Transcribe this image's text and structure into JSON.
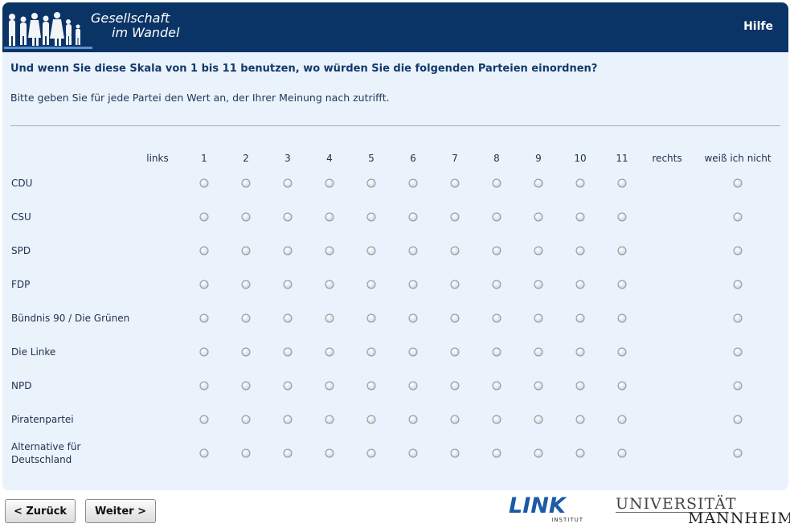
{
  "header": {
    "logo_line1": "Gesellschaft",
    "logo_line2": "im Wandel",
    "help_label": "Hilfe"
  },
  "question": "Und wenn Sie diese Skala von 1 bis 11 benutzen, wo würden Sie die folgenden Parteien einordnen?",
  "instruction": "Bitte geben Sie für jede Partei den Wert an, der Ihrer Meinung nach zutrifft.",
  "scale": {
    "left_label": "links",
    "values": [
      "1",
      "2",
      "3",
      "4",
      "5",
      "6",
      "7",
      "8",
      "9",
      "10",
      "11"
    ],
    "right_label": "rechts",
    "dont_know_label": "weiß ich nicht"
  },
  "parties": [
    "CDU",
    "CSU",
    "SPD",
    "FDP",
    "Bündnis 90 / Die Grünen",
    "Die Linke",
    "NPD",
    "Piratenpartei",
    "Alternative für Deutschland"
  ],
  "buttons": {
    "back": "< Zurück",
    "next": "Weiter >"
  },
  "footer": {
    "link_logo": "LINK",
    "link_sub": "INSTITUT",
    "uni_line1": "UNIVERSITÄT",
    "uni_line2": "MANNHEIM"
  },
  "colors": {
    "header_bg": "#0b3466",
    "panel_bg": "#eaf2fc",
    "link_blue": "#1b5aa6"
  }
}
